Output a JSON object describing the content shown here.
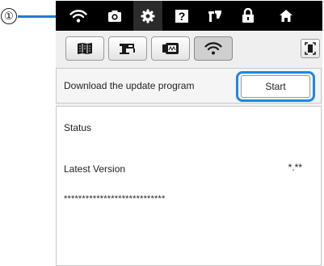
{
  "callout": {
    "number": "①"
  },
  "topbar": {
    "icons": [
      "wifi-icon",
      "camera-icon",
      "gear-icon",
      "help-icon",
      "needle-icon",
      "lock-icon",
      "home-icon"
    ],
    "active": "gear-icon"
  },
  "tabs": {
    "items": [
      "machine-settings-icon",
      "sewing-machine-icon",
      "embroidery-icon",
      "wifi-icon"
    ],
    "selected": "wifi-icon"
  },
  "download": {
    "label": "Download the update program",
    "start_label": "Start"
  },
  "status": {
    "status_label": "Status",
    "latest_version_label": "Latest Version",
    "latest_version_value": "*.**",
    "status_value": "****************************"
  },
  "colors": {
    "highlight": "#1e88e5",
    "topbar": "#000000",
    "callout_line": "#1e7bd6"
  }
}
